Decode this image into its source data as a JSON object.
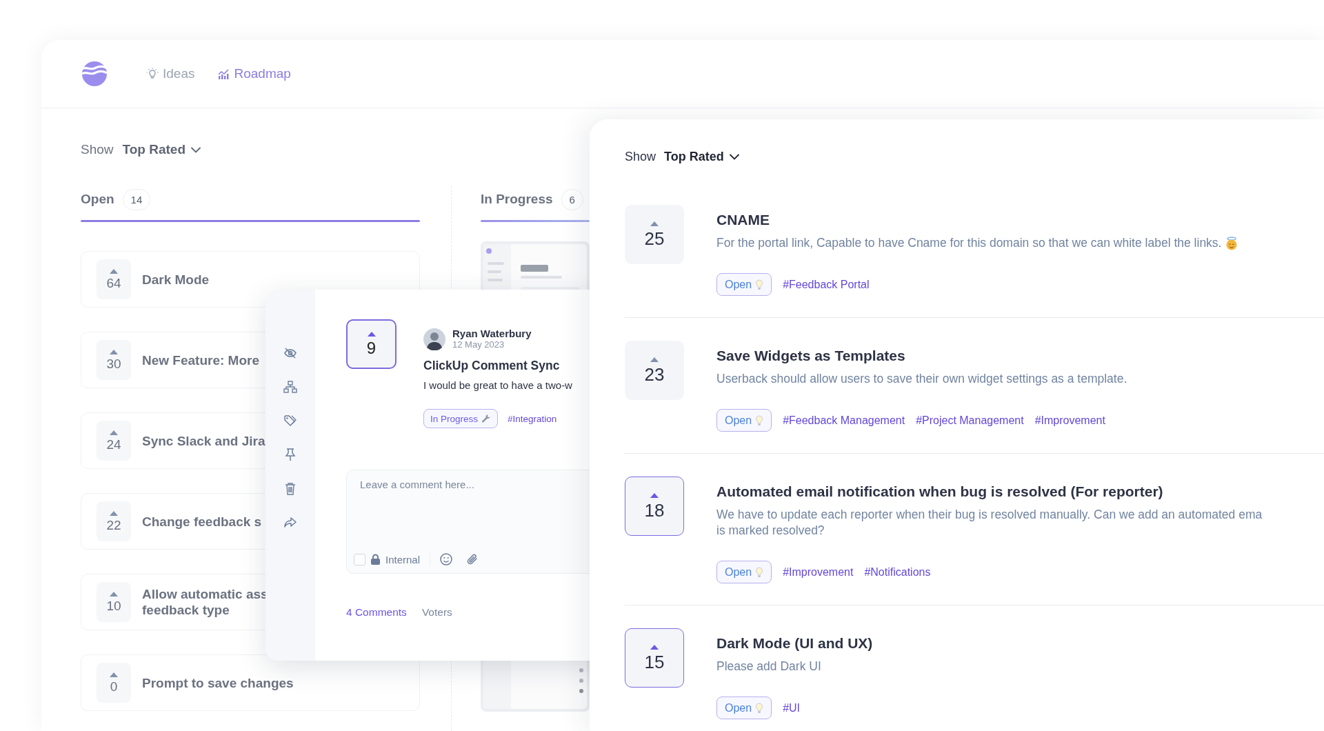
{
  "nav": {
    "tabs": [
      {
        "label": "Ideas",
        "kind": "ideas",
        "selected": false
      },
      {
        "label": "Roadmap",
        "kind": "roadmap",
        "selected": true
      }
    ]
  },
  "board": {
    "sort": {
      "label": "Show",
      "value": "Top Rated"
    },
    "columns": [
      {
        "title": "Open",
        "count": "14",
        "items": [
          {
            "votes": "64",
            "title_lines": [
              "Dark Mode"
            ]
          },
          {
            "votes": "30",
            "title_lines": [
              "New Feature: More"
            ]
          },
          {
            "votes": "24",
            "title_lines": [
              "Sync Slack and Jira"
            ]
          },
          {
            "votes": "22",
            "title_lines": [
              "Change feedback s"
            ]
          },
          {
            "votes": "10",
            "title_lines": [
              "Allow automatic ass",
              "feedback type"
            ]
          },
          {
            "votes": "0",
            "title_lines": [
              "Prompt to save changes"
            ]
          }
        ]
      },
      {
        "title": "In Progress",
        "count": "6"
      }
    ]
  },
  "detail": {
    "votes": "9",
    "voted": true,
    "author": "Ryan Waterbury",
    "date": "12 May 2023",
    "title": "ClickUp Comment Sync",
    "body": "I would be great to have a two-w",
    "status": {
      "label": "In Progress",
      "kind": "in_progress"
    },
    "tags": [
      "#Integration"
    ],
    "comment": {
      "placeholder": "Leave a comment here...",
      "internal": {
        "label": "Internal",
        "checked": false
      }
    },
    "tabs": [
      {
        "label": "4 Comments",
        "selected": true
      },
      {
        "label": "Voters",
        "selected": false
      }
    ]
  },
  "panel": {
    "sort": {
      "label": "Show",
      "value": "Top Rated"
    },
    "ideas": [
      {
        "votes": "25",
        "voted": false,
        "title": "CNAME",
        "description": [
          "For the portal link, Capable to have Cname for this domain so that we can white label the links."
        ],
        "emoji_mark": true,
        "status": {
          "label": "Open",
          "kind": "open"
        },
        "tags": [
          "#Feedback Portal"
        ]
      },
      {
        "votes": "23",
        "voted": false,
        "title": "Save Widgets as Templates",
        "description": [
          "Userback should allow users to save their own widget settings as a template."
        ],
        "status": {
          "label": "Open",
          "kind": "open"
        },
        "tags": [
          "#Feedback Management",
          "#Project Management",
          "#Improvement"
        ]
      },
      {
        "votes": "18",
        "voted": true,
        "title": "Automated email notification when bug is resolved (For reporter)",
        "description": [
          "We have to update each reporter when their bug is resolved manually. Can we add an automated ema",
          "is marked resolved?"
        ],
        "status": {
          "label": "Open",
          "kind": "open"
        },
        "tags": [
          "#Improvement",
          "#Notifications"
        ]
      },
      {
        "votes": "15",
        "voted": true,
        "title": "Dark Mode (UI and UX)",
        "description": [
          "Please add Dark UI"
        ],
        "status": {
          "label": "Open",
          "kind": "open"
        },
        "tags": [
          "#UI"
        ]
      }
    ]
  }
}
